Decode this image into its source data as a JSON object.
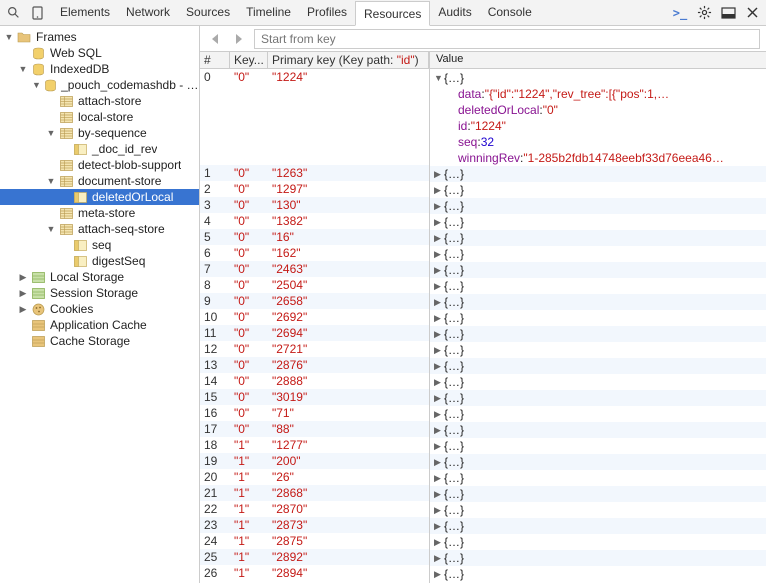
{
  "tabs": [
    "Elements",
    "Network",
    "Sources",
    "Timeline",
    "Profiles",
    "Resources",
    "Audits",
    "Console"
  ],
  "tabs_selected_idx": 5,
  "toolbar": {
    "search_placeholder": "Start from key"
  },
  "grid": {
    "columns": {
      "idx": "#",
      "key": "Key...",
      "pk_prefix": "Primary key (Key path: ",
      "pk_keypath": "\"id\"",
      "pk_suffix": ")"
    },
    "value_header": "Value",
    "rows": [
      {
        "i": 0,
        "k": "\"0\"",
        "pk": "\"1224\""
      },
      {
        "i": 1,
        "k": "\"0\"",
        "pk": "\"1263\""
      },
      {
        "i": 2,
        "k": "\"0\"",
        "pk": "\"1297\""
      },
      {
        "i": 3,
        "k": "\"0\"",
        "pk": "\"130\""
      },
      {
        "i": 4,
        "k": "\"0\"",
        "pk": "\"1382\""
      },
      {
        "i": 5,
        "k": "\"0\"",
        "pk": "\"16\""
      },
      {
        "i": 6,
        "k": "\"0\"",
        "pk": "\"162\""
      },
      {
        "i": 7,
        "k": "\"0\"",
        "pk": "\"2463\""
      },
      {
        "i": 8,
        "k": "\"0\"",
        "pk": "\"2504\""
      },
      {
        "i": 9,
        "k": "\"0\"",
        "pk": "\"2658\""
      },
      {
        "i": 10,
        "k": "\"0\"",
        "pk": "\"2692\""
      },
      {
        "i": 11,
        "k": "\"0\"",
        "pk": "\"2694\""
      },
      {
        "i": 12,
        "k": "\"0\"",
        "pk": "\"2721\""
      },
      {
        "i": 13,
        "k": "\"0\"",
        "pk": "\"2876\""
      },
      {
        "i": 14,
        "k": "\"0\"",
        "pk": "\"2888\""
      },
      {
        "i": 15,
        "k": "\"0\"",
        "pk": "\"3019\""
      },
      {
        "i": 16,
        "k": "\"0\"",
        "pk": "\"71\""
      },
      {
        "i": 17,
        "k": "\"0\"",
        "pk": "\"88\""
      },
      {
        "i": 18,
        "k": "\"1\"",
        "pk": "\"1277\""
      },
      {
        "i": 19,
        "k": "\"1\"",
        "pk": "\"200\""
      },
      {
        "i": 20,
        "k": "\"1\"",
        "pk": "\"26\""
      },
      {
        "i": 21,
        "k": "\"1\"",
        "pk": "\"2868\""
      },
      {
        "i": 22,
        "k": "\"1\"",
        "pk": "\"2870\""
      },
      {
        "i": 23,
        "k": "\"1\"",
        "pk": "\"2873\""
      },
      {
        "i": 24,
        "k": "\"1\"",
        "pk": "\"2875\""
      },
      {
        "i": 25,
        "k": "\"1\"",
        "pk": "\"2892\""
      },
      {
        "i": 26,
        "k": "\"1\"",
        "pk": "\"2894\""
      }
    ]
  },
  "expanded": {
    "collapsed_label": "{…}",
    "props": [
      {
        "name": "data",
        "val": "\"{\"id\":\"1224\",\"rev_tree\":[{\"pos\":1,…",
        "kind": "str"
      },
      {
        "name": "deletedOrLocal",
        "val": "\"0\"",
        "kind": "str"
      },
      {
        "name": "id",
        "val": "\"1224\"",
        "kind": "str"
      },
      {
        "name": "seq",
        "val": "32",
        "kind": "num"
      },
      {
        "name": "winningRev",
        "val": "\"1-285b2fdb14748eebf33d76eea46…",
        "kind": "str"
      }
    ]
  },
  "tree": [
    {
      "d": 0,
      "a": "▼",
      "icon": "folder",
      "t": "Frames"
    },
    {
      "d": 1,
      "a": "",
      "icon": "db",
      "t": "Web SQL"
    },
    {
      "d": 1,
      "a": "▼",
      "icon": "db",
      "t": "IndexedDB"
    },
    {
      "d": 2,
      "a": "▼",
      "icon": "db",
      "t": "_pouch_codemashdb - http..."
    },
    {
      "d": 3,
      "a": "",
      "icon": "table",
      "t": "attach-store"
    },
    {
      "d": 3,
      "a": "",
      "icon": "table",
      "t": "local-store"
    },
    {
      "d": 3,
      "a": "▼",
      "icon": "table",
      "t": "by-sequence"
    },
    {
      "d": 4,
      "a": "",
      "icon": "index",
      "t": "_doc_id_rev"
    },
    {
      "d": 3,
      "a": "",
      "icon": "table",
      "t": "detect-blob-support"
    },
    {
      "d": 3,
      "a": "▼",
      "icon": "table",
      "t": "document-store"
    },
    {
      "d": 4,
      "a": "",
      "icon": "index",
      "t": "deletedOrLocal",
      "selected": true
    },
    {
      "d": 3,
      "a": "",
      "icon": "table",
      "t": "meta-store"
    },
    {
      "d": 3,
      "a": "▼",
      "icon": "table",
      "t": "attach-seq-store"
    },
    {
      "d": 4,
      "a": "",
      "icon": "index",
      "t": "seq"
    },
    {
      "d": 4,
      "a": "",
      "icon": "index",
      "t": "digestSeq"
    },
    {
      "d": 1,
      "a": "▶",
      "icon": "storage",
      "t": "Local Storage"
    },
    {
      "d": 1,
      "a": "▶",
      "icon": "storage",
      "t": "Session Storage"
    },
    {
      "d": 1,
      "a": "▶",
      "icon": "cookies",
      "t": "Cookies"
    },
    {
      "d": 1,
      "a": "",
      "icon": "appcache",
      "t": "Application Cache"
    },
    {
      "d": 1,
      "a": "",
      "icon": "appcache",
      "t": "Cache Storage"
    }
  ]
}
